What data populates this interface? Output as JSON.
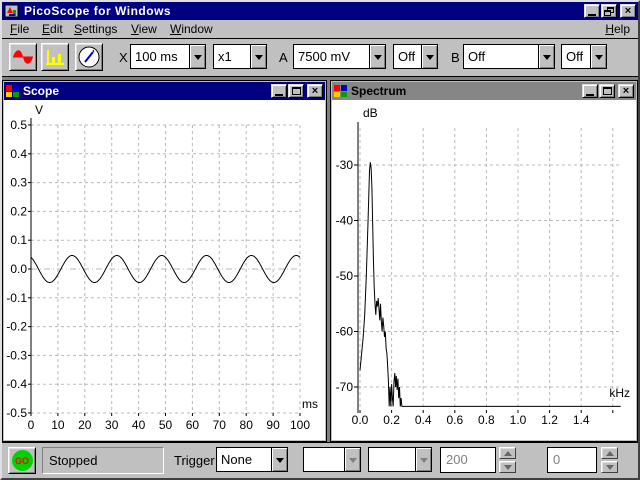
{
  "titlebar": {
    "title": "PicoScope for Windows"
  },
  "menu": {
    "items": [
      "File",
      "Edit",
      "Settings",
      "View",
      "Window"
    ],
    "help": "Help"
  },
  "toolbar": {
    "x_label": "X",
    "timebase_value": "100 ms",
    "multiplier_value": "x1",
    "a_label": "A",
    "channel_a_range": "7500 mV",
    "channel_a_mode": "Off",
    "b_label": "B",
    "channel_b_range": "Off",
    "channel_b_mode": "Off"
  },
  "icons": {
    "app_icon": "picoscope-logo",
    "scope_view_icon": "red-sine-wave",
    "spectrum_view_icon": "yellow-bar-chart",
    "meter_view_icon": "gauge-dial",
    "minimize": "underscore-bar",
    "maximize": "square",
    "restore": "overlapping-windows",
    "close": "x-cross",
    "dropdown": "down-triangle",
    "spin_up": "up-triangle",
    "spin_down": "down-triangle"
  },
  "scope_window": {
    "title": "Scope"
  },
  "spectrum_window": {
    "title": "Spectrum"
  },
  "status_bar": {
    "go_label": "GO",
    "status_text": "Stopped",
    "trigger_label": "Trigger",
    "trigger_value": "None",
    "disabled_combo_1": "",
    "disabled_combo_2": "",
    "spin_value_1": "200",
    "spin_value_2": "0"
  },
  "colors": {
    "titlebar_active": "#000080",
    "titlebar_inactive": "#868686",
    "chrome": "#c0c0c0",
    "go_green": "#00d400",
    "go_text": "#ff0000",
    "scope_icon_red": "#ff0000",
    "spectrum_icon_yellow": "#ffff00",
    "grid": "#b8b8b8",
    "trace": "#000000"
  },
  "chart_data": [
    {
      "type": "line",
      "title": "Scope",
      "xlabel": "ms",
      "ylabel": "V",
      "xlim": [
        0,
        100
      ],
      "ylim": [
        -0.5,
        0.5
      ],
      "x_ticks": [
        "0",
        "10",
        "20",
        "30",
        "40",
        "50",
        "60",
        "70",
        "80",
        "90",
        "100"
      ],
      "y_ticks": [
        "0.5",
        "0.4",
        "0.3",
        "0.2",
        "0.1",
        "0.0",
        "-0.1",
        "-0.2",
        "-0.3",
        "-0.4",
        "-0.5"
      ],
      "grid": "dashed",
      "signal": {
        "shape": "sine",
        "amplitude_v": 0.047,
        "frequency_hz": 60,
        "phase_deg": 120,
        "offset_v": 0
      }
    },
    {
      "type": "line",
      "title": "Spectrum",
      "xlabel": "kHz",
      "ylabel": "dB",
      "xlim": [
        0,
        1.65
      ],
      "ylim": [
        -75,
        -25
      ],
      "x_ticks": [
        "0.0",
        "0.2",
        "0.4",
        "0.6",
        "0.8",
        "1.0",
        "1.2",
        "1.4"
      ],
      "y_ticks": [
        "-30",
        "-40",
        "-50",
        "-60",
        "-70"
      ],
      "grid": "dashed",
      "points": [
        [
          0.0,
          -67
        ],
        [
          0.01,
          -64
        ],
        [
          0.02,
          -61
        ],
        [
          0.03,
          -57
        ],
        [
          0.04,
          -50
        ],
        [
          0.05,
          -41
        ],
        [
          0.06,
          -31
        ],
        [
          0.065,
          -29.5
        ],
        [
          0.07,
          -30.5
        ],
        [
          0.075,
          -34
        ],
        [
          0.08,
          -40
        ],
        [
          0.085,
          -47
        ],
        [
          0.09,
          -52
        ],
        [
          0.095,
          -55
        ],
        [
          0.1,
          -57
        ],
        [
          0.105,
          -54.5
        ],
        [
          0.11,
          -55.5
        ],
        [
          0.115,
          -54
        ],
        [
          0.12,
          -56
        ],
        [
          0.125,
          -58
        ],
        [
          0.13,
          -55
        ],
        [
          0.135,
          -58
        ],
        [
          0.14,
          -60
        ],
        [
          0.145,
          -57.5
        ],
        [
          0.15,
          -59
        ],
        [
          0.155,
          -61
        ],
        [
          0.16,
          -60
        ],
        [
          0.165,
          -63
        ],
        [
          0.17,
          -64
        ],
        [
          0.175,
          -66
        ],
        [
          0.18,
          -69
        ],
        [
          0.185,
          -73.5
        ],
        [
          0.19,
          -70
        ],
        [
          0.195,
          -73.5
        ],
        [
          0.2,
          -69.5
        ],
        [
          0.205,
          -72
        ],
        [
          0.21,
          -73.5
        ],
        [
          0.215,
          -69
        ],
        [
          0.22,
          -67.5
        ],
        [
          0.225,
          -70
        ],
        [
          0.23,
          -68
        ],
        [
          0.235,
          -70.5
        ],
        [
          0.24,
          -68.5
        ],
        [
          0.245,
          -72
        ],
        [
          0.25,
          -70
        ],
        [
          0.255,
          -73.5
        ],
        [
          0.26,
          -72
        ],
        [
          0.265,
          -73.5
        ],
        [
          0.27,
          -73.5
        ],
        [
          1.65,
          -73.5
        ]
      ]
    }
  ]
}
